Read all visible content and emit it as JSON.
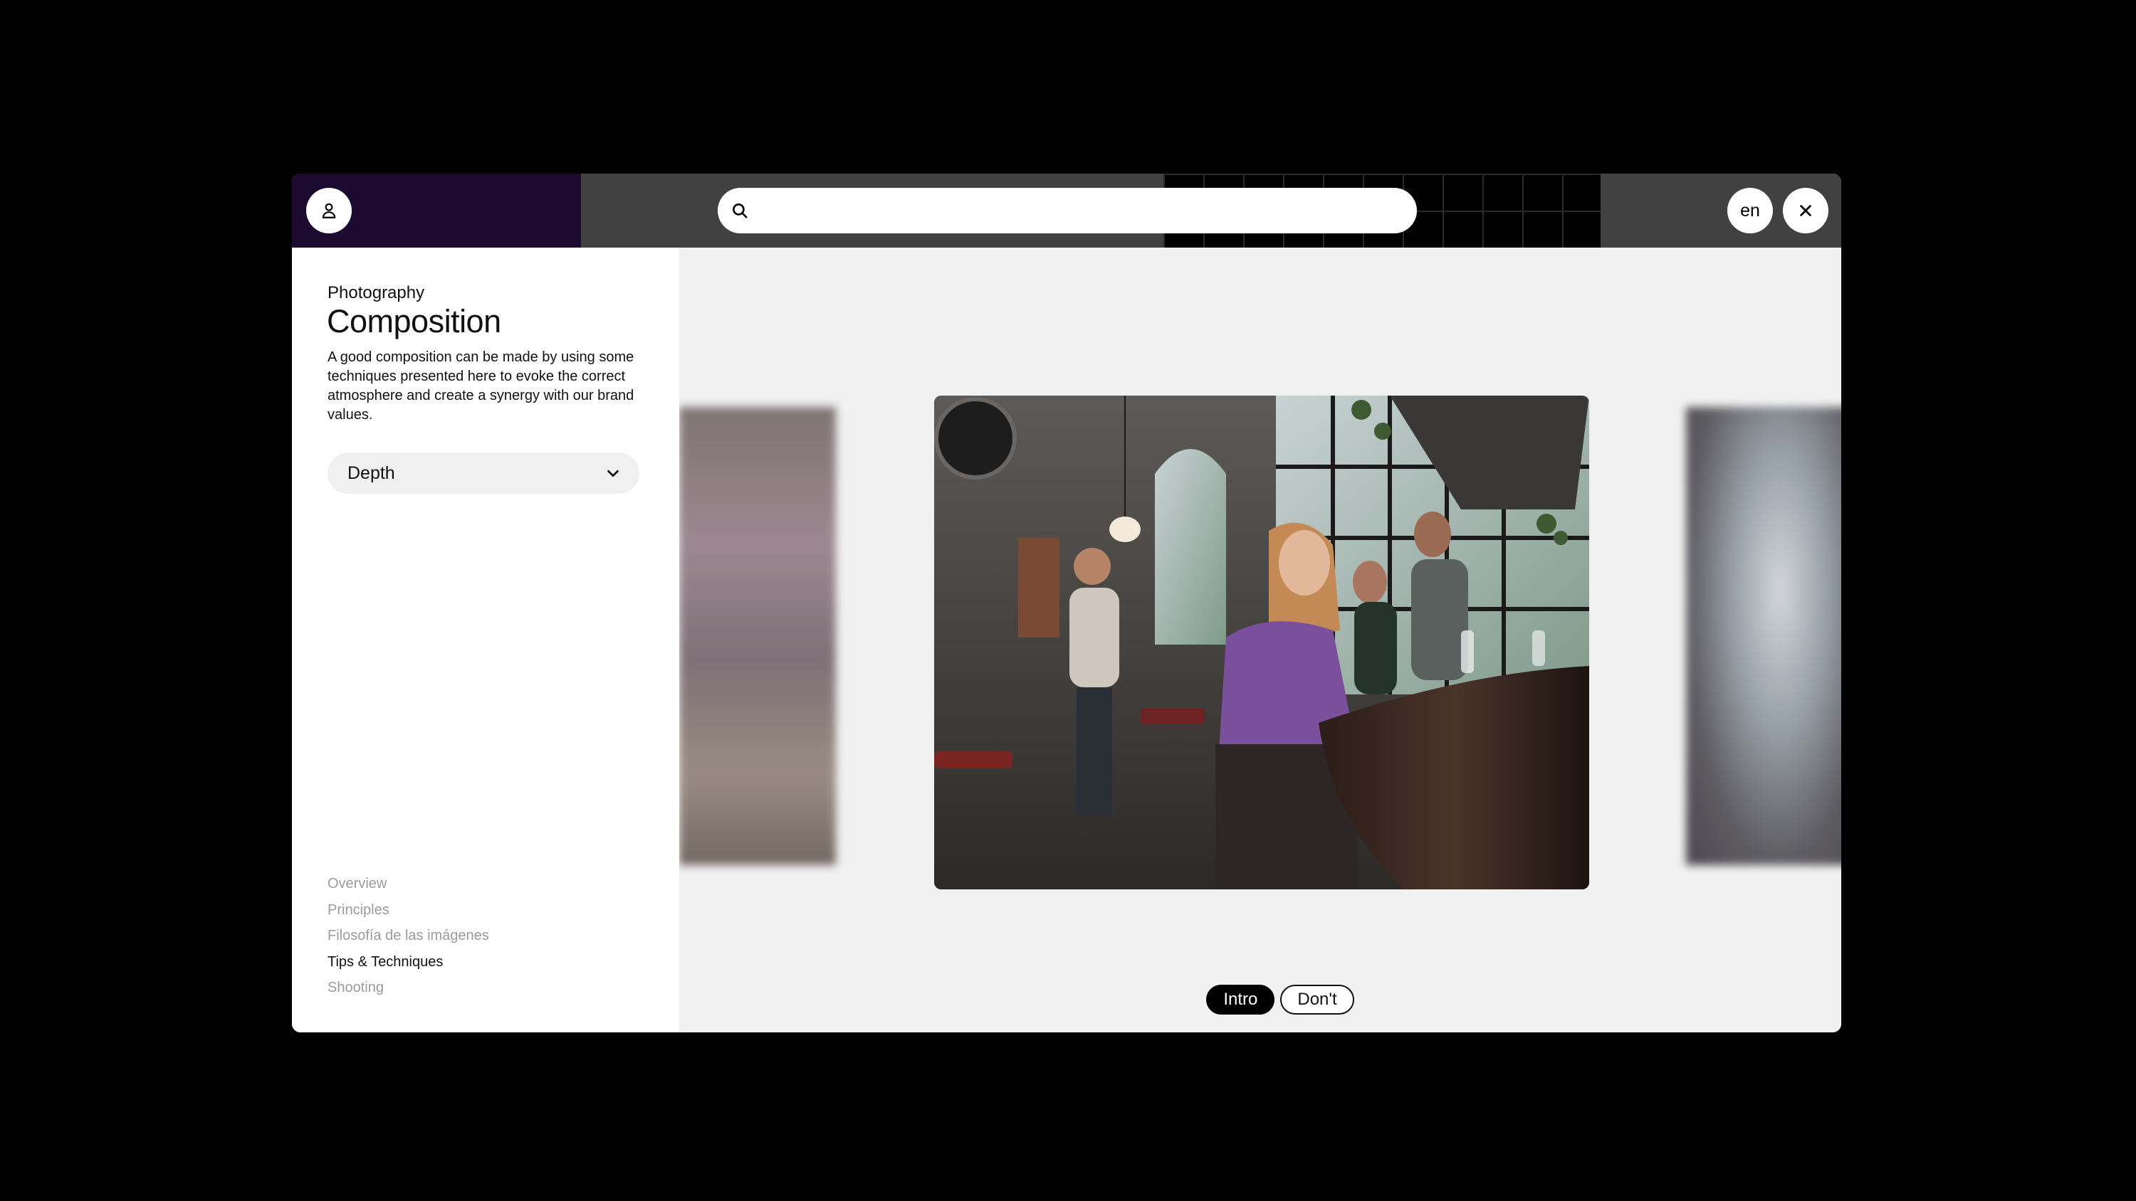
{
  "header": {
    "search_placeholder": "",
    "language": "en"
  },
  "icons": {
    "profile": "user-icon",
    "search": "search-icon",
    "close": "close-icon",
    "dropdown": "chevron-down-icon"
  },
  "sidebar": {
    "eyebrow": "Photography",
    "title": "Composition",
    "description": "A good composition can be made by using some techniques presented here to evoke the correct atmosphere and create a synergy with our brand values.",
    "dropdown_value": "Depth",
    "nav": [
      {
        "label": "Overview",
        "active": false
      },
      {
        "label": "Principles",
        "active": false
      },
      {
        "label": "Filosofía de las imágenes",
        "active": false
      },
      {
        "label": "Tips & Techniques",
        "active": true
      },
      {
        "label": "Shooting",
        "active": false
      }
    ]
  },
  "gallery": {
    "tabs": [
      {
        "label": "Intro",
        "active": true
      },
      {
        "label": "Don't",
        "active": false
      }
    ]
  },
  "colors": {
    "topbar": "#414141",
    "topbar_accent": "#1d0a30",
    "canvas": "#f1f1f1",
    "active_pill": "#000000"
  }
}
